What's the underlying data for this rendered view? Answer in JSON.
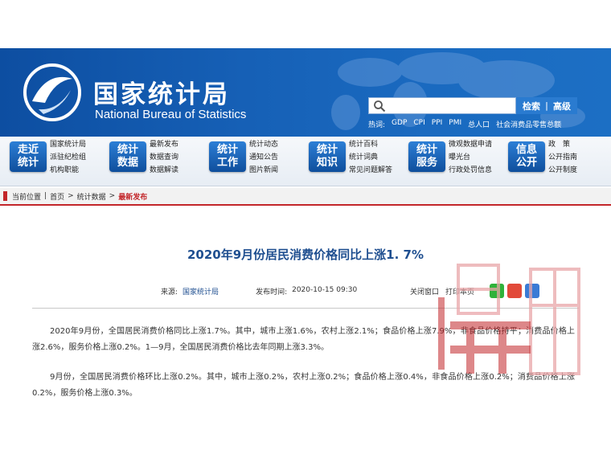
{
  "header": {
    "logo_cn": "国家统计局",
    "logo_en": "National Bureau of Statistics",
    "search_button": "检索",
    "advanced_button": "高级",
    "hotwords_label": "热词:",
    "hotwords": [
      "GDP",
      "CPI",
      "PPI",
      "PMI",
      "总人口",
      "社会消费品零售总额"
    ]
  },
  "nav": [
    {
      "badge": [
        "走近",
        "统计"
      ],
      "links": [
        "国家统计局",
        "派驻纪检组",
        "机构职能"
      ]
    },
    {
      "badge": [
        "统计",
        "数据"
      ],
      "links": [
        "最新发布",
        "数据查询",
        "数据解读"
      ]
    },
    {
      "badge": [
        "统计",
        "工作"
      ],
      "links": [
        "统计动态",
        "通知公告",
        "图片新闻"
      ]
    },
    {
      "badge": [
        "统计",
        "知识"
      ],
      "links": [
        "统计百科",
        "统计词典",
        "常见问题解答"
      ]
    },
    {
      "badge": [
        "统计",
        "服务"
      ],
      "links": [
        "微观数据申请",
        "曝光台",
        "行政处罚信息"
      ]
    },
    {
      "badge": [
        "信息",
        "公开"
      ],
      "links": [
        "政　策",
        "公开指南",
        "公开制度"
      ]
    }
  ],
  "breadcrumb": {
    "label": "当前位置",
    "items": [
      "首页",
      "统计数据",
      "最新发布"
    ]
  },
  "article": {
    "title": "2020年9月份居民消费价格同比上涨1. 7%",
    "source_label": "来源:",
    "source": "国家统计局",
    "date_label": "发布时间:",
    "date": "2020-10-15 09:30",
    "close": "关闭窗口",
    "print": "打印本页",
    "paragraphs": [
      "2020年9月份，全国居民消费价格同比上涨1.7%。其中，城市上涨1.6%，农村上涨2.1%；食品价格上涨7.9%，非食品价格持平；消费品价格上涨2.6%，服务价格上涨0.2%。1—9月，全国居民消费价格比去年同期上涨3.3%。",
      "9月份，全国居民消费价格环比上涨0.2%。其中，城市上涨0.2%，农村上涨0.2%；食品价格上涨0.4%，非食品价格上涨0.2%；消费品价格上涨0.2%，服务价格上涨0.3%。"
    ]
  },
  "watermark": {
    "text": "壹同",
    "url": "www.1dtm.com"
  },
  "colors": {
    "header_blue": "#1660b6",
    "accent_red": "#c3262a",
    "title_blue": "#1f4f90"
  }
}
